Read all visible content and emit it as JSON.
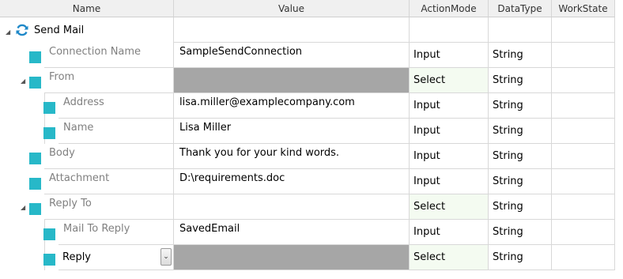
{
  "columns": [
    "Name",
    "Value",
    "ActionMode",
    "DataType",
    "WorkState"
  ],
  "root": {
    "title": "Send Mail",
    "icon": "refresh-icon"
  },
  "rows": [
    {
      "name": "Connection Name",
      "value": "SampleSendConnection",
      "mode": "Input",
      "type": "String"
    },
    {
      "name": "From",
      "value": "",
      "mode": "Select",
      "type": "String"
    },
    {
      "name": "Address",
      "value": "lisa.miller@examplecompany.com",
      "mode": "Input",
      "type": "String"
    },
    {
      "name": "Name",
      "value": "Lisa Miller",
      "mode": "Input",
      "type": "String"
    },
    {
      "name": "Body",
      "value": "Thank you for your kind words.",
      "mode": "Input",
      "type": "String"
    },
    {
      "name": "Attachment",
      "value": "D:\\requirements.doc",
      "mode": "Input",
      "type": "String"
    },
    {
      "name": "Reply To",
      "value": "",
      "mode": "Select",
      "type": "String"
    },
    {
      "name": "Mail To Reply",
      "value": "SavedEmail",
      "mode": "Input",
      "type": "String"
    },
    {
      "name": "Reply",
      "value": "",
      "mode": "Select",
      "type": "String"
    }
  ],
  "colors": {
    "node_square": "#27b8c8",
    "select_bg": "#f4fbf1",
    "disabled_value": "#a6a6a6"
  }
}
